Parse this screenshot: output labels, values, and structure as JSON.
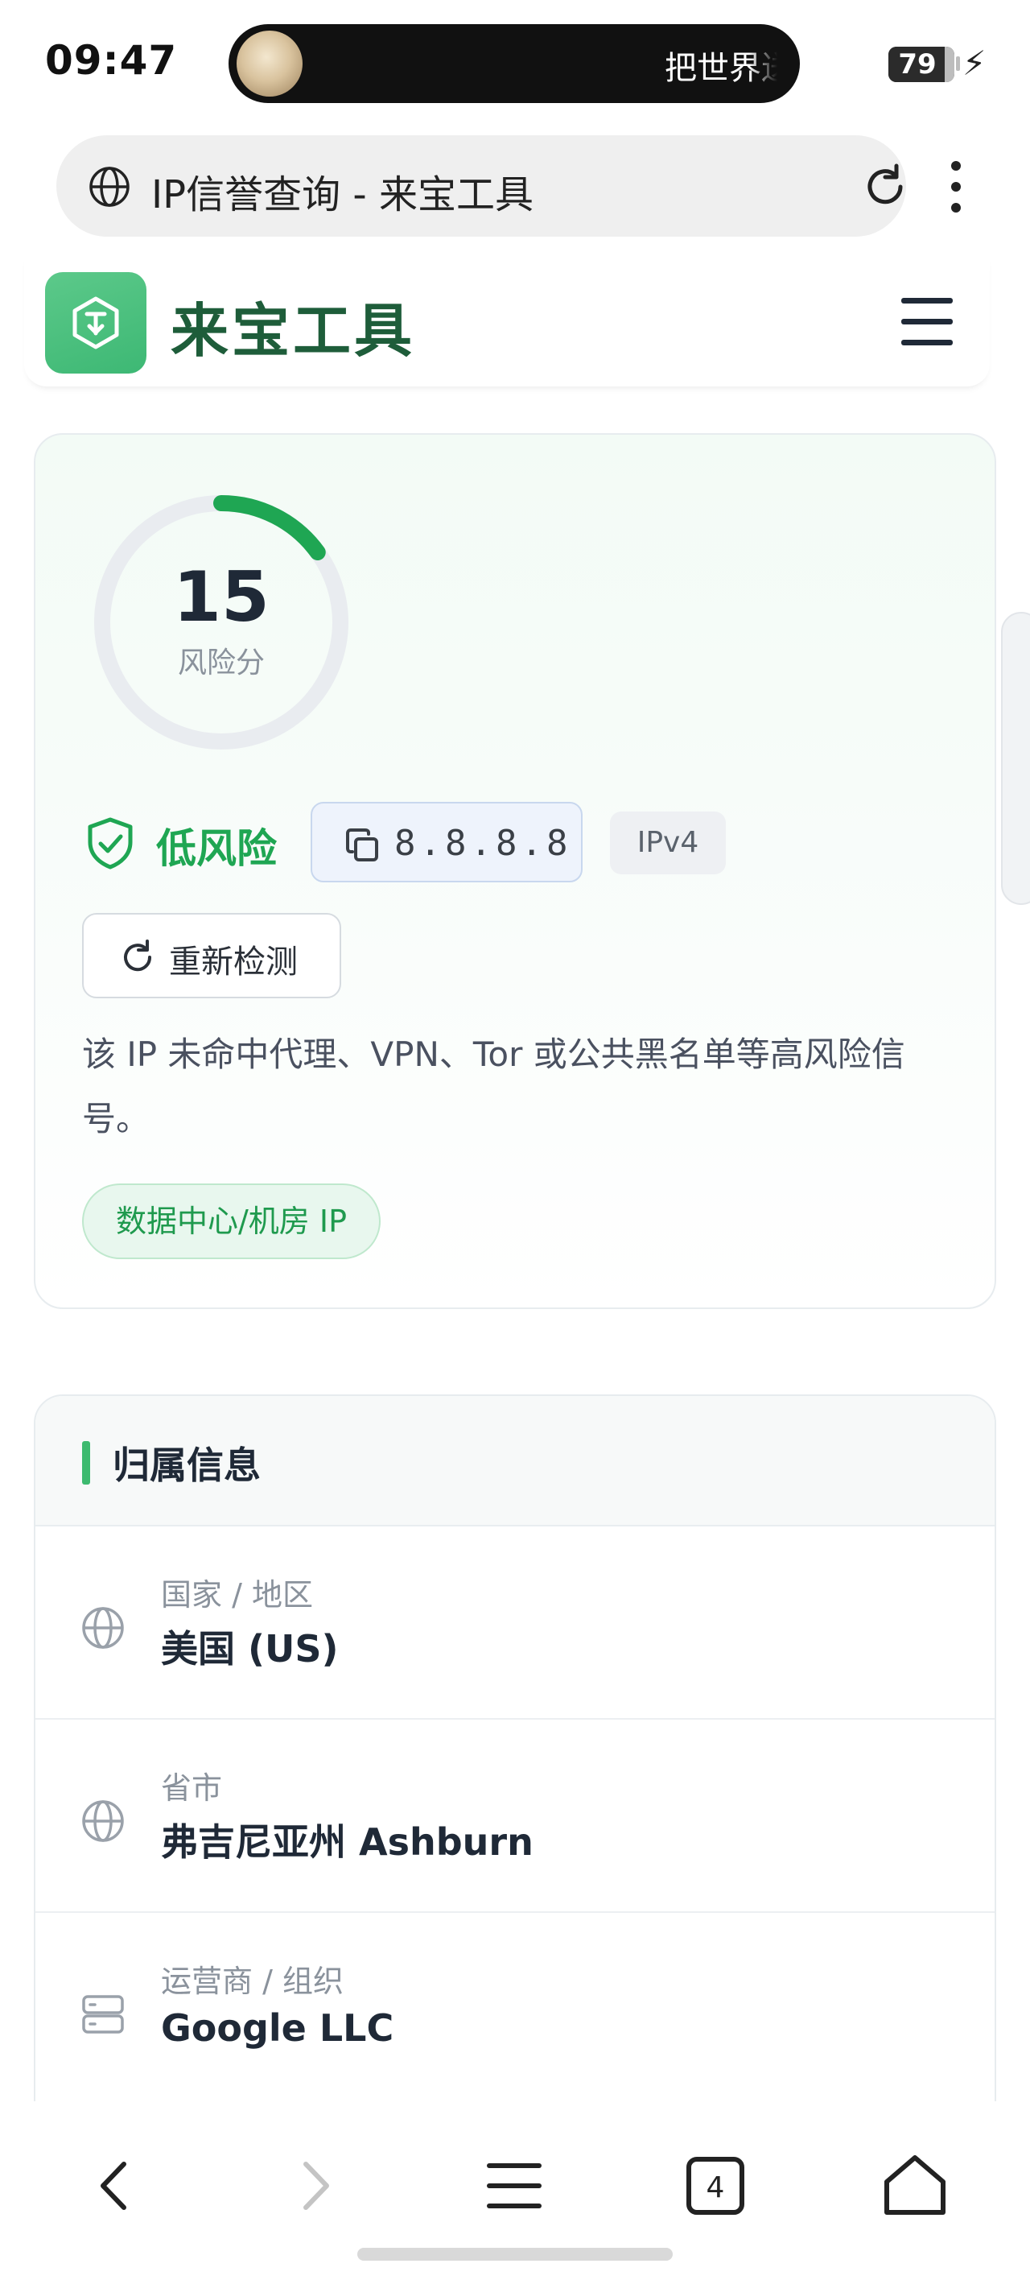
{
  "status_bar": {
    "time": "09:47",
    "island_text": "把世界送",
    "battery": "79",
    "battery_level": 0.79
  },
  "browser": {
    "page_title": "IP信誉查询 - 来宝工具"
  },
  "site": {
    "name": "来宝工具"
  },
  "risk": {
    "score": "15",
    "score_value": 15,
    "score_label": "风险分",
    "level": "低风险",
    "ip": "8.8.8.8",
    "ip_version": "IPv4",
    "recheck_label": "重新检测",
    "description": "该 IP 未命中代理、VPN、Tor 或公共黑名单等高风险信号。",
    "tag": "数据中心/机房 IP",
    "colors": {
      "accent": "#1fa653",
      "track": "#e9ecf0"
    }
  },
  "attribution": {
    "title": "归属信息",
    "rows": [
      {
        "label": "国家 / 地区",
        "value": "美国 (US)",
        "icon": "globe-icon"
      },
      {
        "label": "省市",
        "value": "弗吉尼亚州 Ashburn",
        "icon": "globe-icon"
      },
      {
        "label": "运营商 / 组织",
        "value": "Google LLC",
        "icon": "server-icon"
      }
    ]
  },
  "bottom_nav": {
    "tab_count": "4"
  }
}
